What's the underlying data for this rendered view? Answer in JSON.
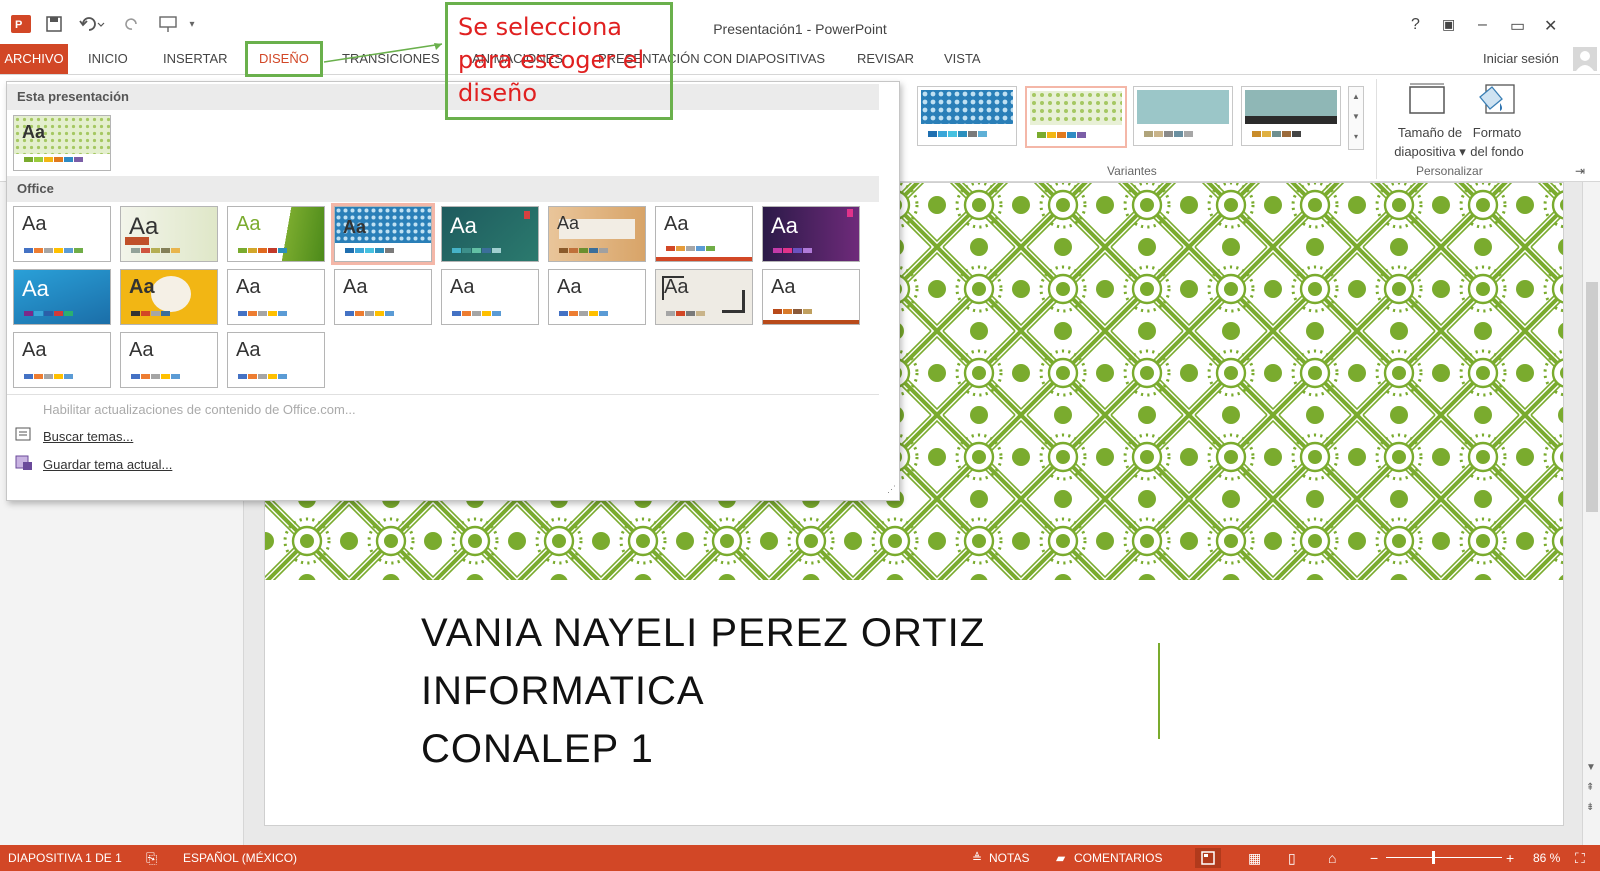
{
  "window": {
    "title": "Presentación1 - PowerPoint",
    "help": "?",
    "minimize": "–",
    "restore": "▭",
    "close": "✕",
    "signin": "Iniciar sesión"
  },
  "tabs": [
    "ARCHIVO",
    "INICIO",
    "INSERTAR",
    "DISEÑO",
    "TRANSICIONES",
    "ANIMACIONES",
    "PRESENTACIÓN CON DIAPOSITIVAS",
    "REVISAR",
    "VISTA"
  ],
  "ribbon": {
    "variants_label": "Variantes",
    "customize_label": "Personalizar",
    "slide_size": [
      "Tamaño de",
      "diapositiva ▾"
    ],
    "bg_format": [
      "Formato",
      "del fondo"
    ]
  },
  "gallery": {
    "section_this": "Esta presentación",
    "section_office": "Office",
    "theme_text": "Aa",
    "menu_update": "Habilitar actualizaciones de contenido de Office.com...",
    "menu_search": "Buscar temas...",
    "menu_save": "Guardar tema actual..."
  },
  "slide": {
    "lines": [
      "VANIA NAYELI PEREZ ORTIZ",
      "INFORMATICA",
      "CONALEP 1"
    ]
  },
  "status": {
    "slide": "DIAPOSITIVA 1 DE 1",
    "language": "ESPAÑOL (MÉXICO)",
    "notes": "NOTAS",
    "comments": "COMENTARIOS",
    "zoom": "86 %"
  },
  "annotation": {
    "lines": [
      "Se selecciona",
      "para escoger el",
      "diseño"
    ]
  },
  "colors": {
    "accent": "#d24726",
    "annotation_border": "#6ab04c",
    "annotation_text": "#e02020",
    "pattern_green": "#7aab2e"
  }
}
